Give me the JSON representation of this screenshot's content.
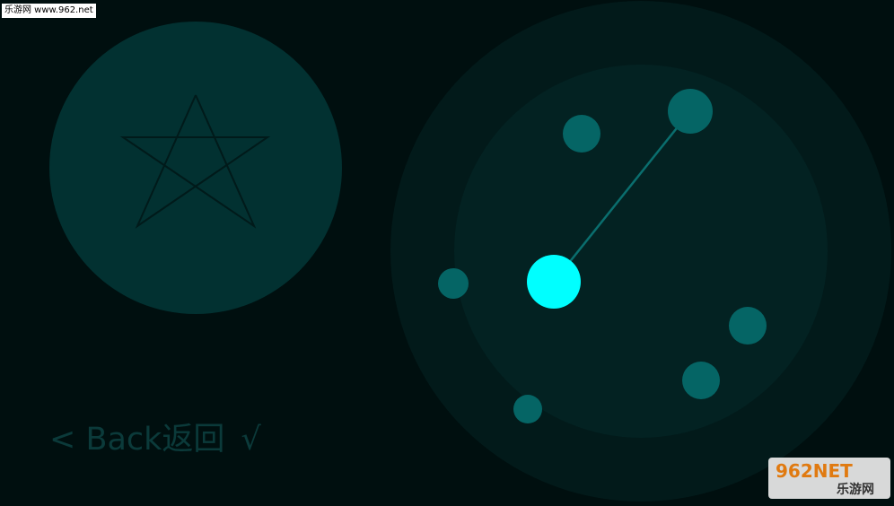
{
  "watermark_top": {
    "text": "乐游网 www.962.net"
  },
  "controls": {
    "back_label": "< Back返回",
    "confirm_label": "√"
  },
  "target_shape": {
    "name": "star-pattern"
  },
  "pattern_board": {
    "dots": [
      {
        "id": "dot-top-left",
        "active": false
      },
      {
        "id": "dot-top-right",
        "active": true
      },
      {
        "id": "dot-left",
        "active": false
      },
      {
        "id": "dot-center",
        "active": true
      },
      {
        "id": "dot-right",
        "active": false
      },
      {
        "id": "dot-bottom-right",
        "active": false
      },
      {
        "id": "dot-bottom-left",
        "active": false
      }
    ]
  },
  "watermark_logo": {
    "line1": "962NET",
    "line2": "乐游网"
  },
  "colors": {
    "background": "#000f0f",
    "panel": "#023131",
    "outer_ring": "#021a1a",
    "inner_ring": "#032222",
    "dot": "#056565",
    "dot_active": "#00ffff",
    "line": "#0a6e6e",
    "text_dim": "#0b3a3a"
  }
}
